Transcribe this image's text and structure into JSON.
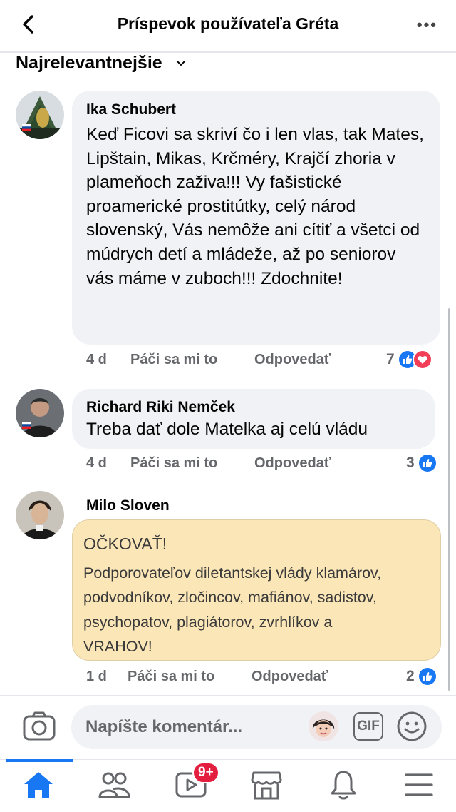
{
  "header": {
    "title": "Príspevok používateľa Gréta"
  },
  "sort": {
    "label": "Najrelevantnejšie"
  },
  "comments": [
    {
      "author": "Ika Schubert",
      "text": "Keď Ficovi  sa skriví čo i len vlas, tak Mates, Lipštain, Mikas, Krčméry, Krajčí zhoria v plameňoch zaživa!!! Vy fašistické proamerické prostitútky, celý národ slovenský, Vás nemôže ani cítiť a všetci od múdrych detí a mládeže, až po seniorov vás máme v zuboch!!! Zdochnite!",
      "age": "4 d",
      "like": "Páči sa mi to",
      "reply": "Odpovedať",
      "reactions": "7"
    },
    {
      "author": "Richard Riki Nemček",
      "text": "Treba dať dole Matelka aj celú vládu",
      "age": "4 d",
      "like": "Páči sa mi to",
      "reply": "Odpovedať",
      "reactions": "3"
    },
    {
      "author": "Milo Sloven",
      "text_title": "OČKOVAŤ!",
      "text": "Podporovateľov diletantskej vlády klamárov, podvodníkov, zločincov, mafiánov, sadistov, psychopatov, plagiátorov, zvrhlíkov a",
      "text_end": "VRAHOV!",
      "age": "1 d",
      "like": "Páči sa mi to",
      "reply": "Odpovedať",
      "reactions": "2"
    }
  ],
  "composer": {
    "placeholder": "Napíšte komentár...",
    "gif_label": "GIF"
  },
  "tabs": {
    "video_badge": "9+"
  },
  "colors": {
    "accent": "#1877f2",
    "bubble": "#f0f2f5",
    "highlight_bubble": "#fbe6b7",
    "badge": "#e41e3f",
    "love": "#f33e58"
  },
  "icons": [
    "back-arrow-icon",
    "more-icon",
    "chevron-down-icon",
    "like-reaction-icon",
    "love-reaction-icon",
    "camera-icon",
    "avatar-emoji-icon",
    "gif-icon",
    "smiley-icon",
    "home-icon",
    "friends-icon",
    "video-icon",
    "marketplace-icon",
    "bell-icon",
    "menu-icon"
  ]
}
